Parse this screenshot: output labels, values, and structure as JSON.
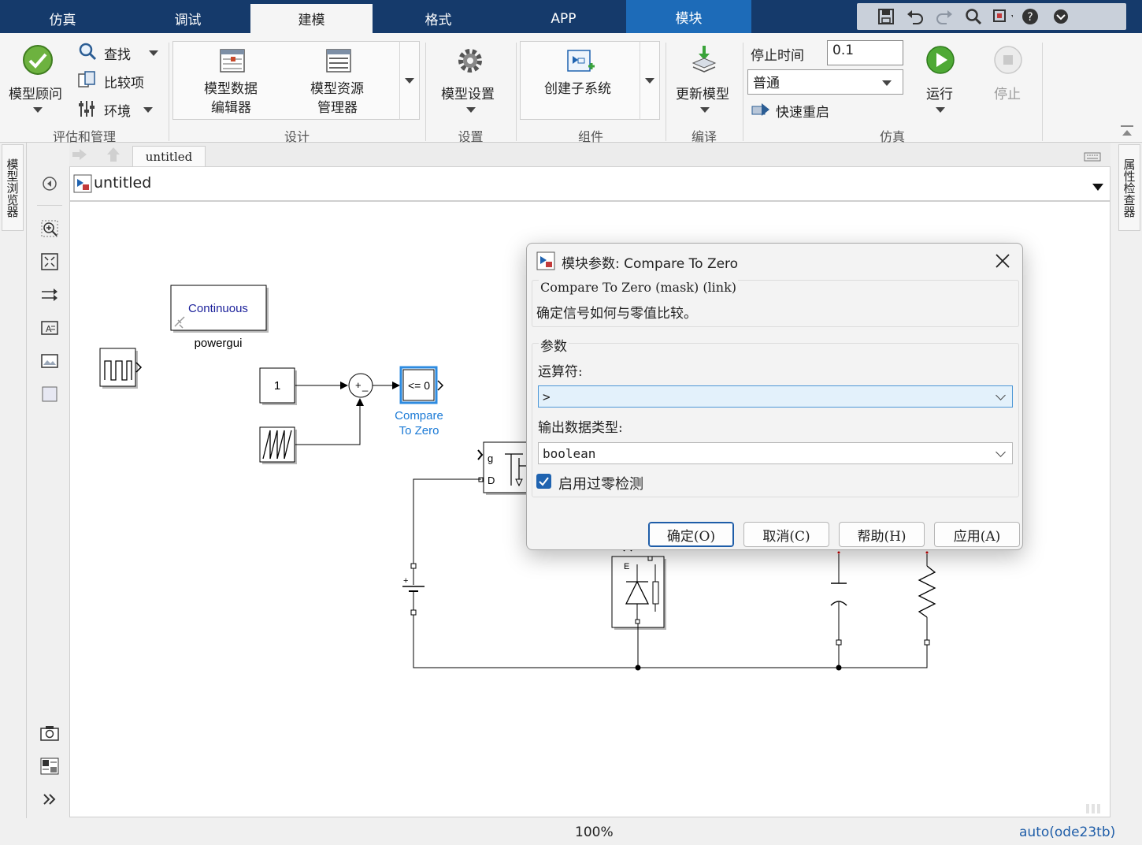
{
  "tabs": [
    {
      "label": "仿真",
      "state": "normal"
    },
    {
      "label": "调试",
      "state": "normal"
    },
    {
      "label": "建模",
      "state": "active"
    },
    {
      "label": "格式",
      "state": "normal"
    },
    {
      "label": "APP",
      "state": "normal"
    },
    {
      "label": "模块",
      "state": "contextual"
    }
  ],
  "quick_access": [
    "save-icon",
    "undo-icon",
    "redo-icon",
    "search-icon",
    "find-window-icon",
    "help-icon",
    "collapse-icon"
  ],
  "ribbon": {
    "evaluate": {
      "label": "评估和管理",
      "model_advisor": "模型顾问",
      "find": "查找",
      "compare": "比较项",
      "environment": "环境"
    },
    "design": {
      "label": "设计",
      "data_editor_l1": "模型数据",
      "data_editor_l2": "编辑器",
      "resource_l1": "模型资源",
      "resource_l2": "管理器"
    },
    "setup": {
      "label": "设置",
      "model_settings": "模型设置"
    },
    "component": {
      "label": "组件",
      "create_subsystem": "创建子系统"
    },
    "compile": {
      "label": "编译",
      "update_model": "更新模型"
    },
    "simulation": {
      "label": "仿真",
      "stop_time_label": "停止时间",
      "stop_time_value": "0.1",
      "mode": "普通",
      "fast_restart": "快速重启",
      "run": "运行",
      "stop": "停止"
    }
  },
  "side": {
    "left_tab": "模型浏览器",
    "right_tab": "属性检查器"
  },
  "editor": {
    "crumb": "untitled",
    "model_name": "untitled"
  },
  "diagram": {
    "powergui_mode": "Continuous",
    "powergui_name": "powergui",
    "constant_value": "1",
    "sum_signs_plus": "+",
    "sum_signs_minus": "_",
    "compare_expr": "<= 0",
    "compare_name_l1": "Compare",
    "compare_name_l2": "To Zero",
    "mosfet_g": "g",
    "mosfet_d": "D",
    "diode_e": "E",
    "dc_plus": "+"
  },
  "dialog": {
    "title": "模块参数: Compare To Zero",
    "mask_header": "Compare To Zero (mask) (link)",
    "description": "确定信号如何与零值比较。",
    "params_label": "参数",
    "operator_label": "运算符:",
    "operator_value": ">",
    "output_type_label": "输出数据类型:",
    "output_type_value": "boolean",
    "zero_crossing_label": "启用过零检测",
    "zero_crossing_checked": true,
    "ok": "确定(O)",
    "cancel": "取消(C)",
    "help": "帮助(H)",
    "apply": "应用(A)"
  },
  "status": {
    "zoom": "100%",
    "solver": "auto(ode23tb)"
  },
  "colors": {
    "tabbar": "#153a6b",
    "context_tab": "#1d6bb8",
    "accent_blue": "#1e5da8",
    "block_label_blue": "#1b7ad6"
  }
}
